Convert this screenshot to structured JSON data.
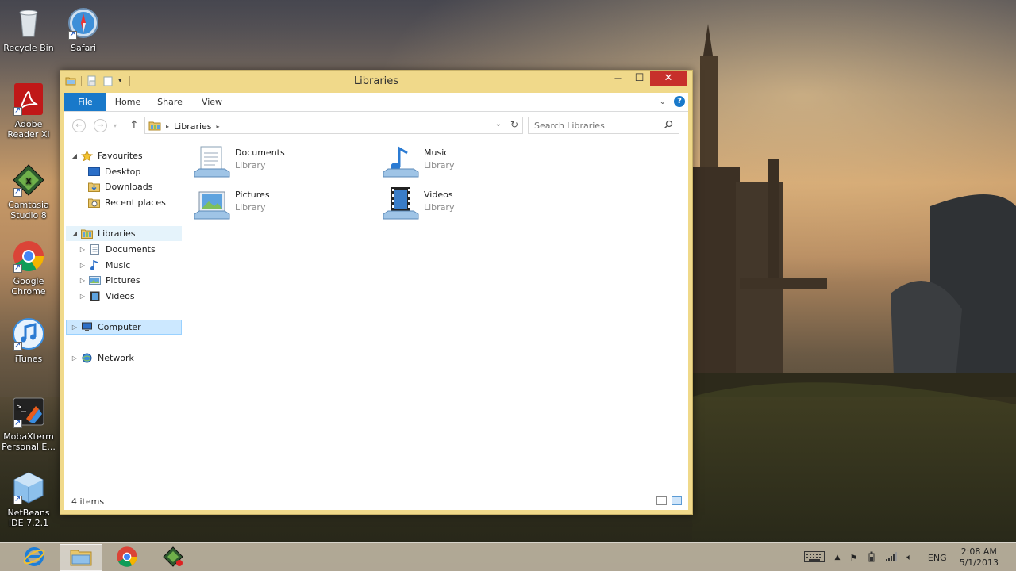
{
  "desktop": {
    "icons": [
      {
        "label": "Recycle Bin"
      },
      {
        "label": "Safari"
      },
      {
        "label": "Adobe Reader XI"
      },
      {
        "label": "Camtasia Studio 8"
      },
      {
        "label": "Google Chrome"
      },
      {
        "label": "iTunes"
      },
      {
        "label": "MobaXterm Personal E..."
      },
      {
        "label": "NetBeans IDE 7.2.1"
      }
    ]
  },
  "window": {
    "title": "Libraries",
    "close_glyph": "✕",
    "maximize_glyph": "☐",
    "minimize_glyph": "—"
  },
  "ribbon": {
    "tabs": [
      "File",
      "Home",
      "Share",
      "View"
    ]
  },
  "address": {
    "crumbs": [
      "Libraries"
    ],
    "search_placeholder": "Search Libraries"
  },
  "navpane": {
    "favourites": {
      "label": "Favourites",
      "items": [
        "Desktop",
        "Downloads",
        "Recent places"
      ]
    },
    "libraries": {
      "label": "Libraries",
      "items": [
        "Documents",
        "Music",
        "Pictures",
        "Videos"
      ]
    },
    "computer": "Computer",
    "network": "Network"
  },
  "content": {
    "tiles": [
      {
        "name": "Documents",
        "type": "Library"
      },
      {
        "name": "Music",
        "type": "Library"
      },
      {
        "name": "Pictures",
        "type": "Library"
      },
      {
        "name": "Videos",
        "type": "Library"
      }
    ]
  },
  "statusbar": {
    "count": "4 items"
  },
  "taskbar": {
    "language": "ENG",
    "time": "2:08 AM",
    "date": "5/1/2013"
  },
  "colors": {
    "accent": "#1979ca",
    "close": "#c7302b",
    "window_frame": "#f0d98a",
    "selection": "#cce8ff"
  }
}
